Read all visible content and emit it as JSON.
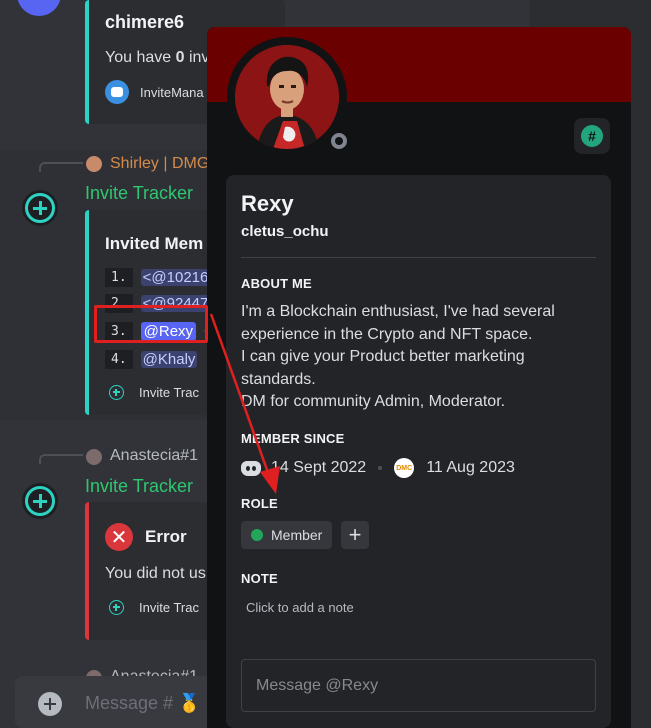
{
  "chat": {
    "msg1": {
      "author": "chimere6",
      "body_prefix": "You have ",
      "body_bold": "0",
      "body_suffix": " inv",
      "footer": "InviteMana"
    },
    "msg2": {
      "reply_author": "Shirley | DMG",
      "bot_name": "Invite Tracker",
      "embed_title": "Invited Mem",
      "list": [
        {
          "num": "1.",
          "mention": "<@10216"
        },
        {
          "num": "2.",
          "mention": "<@92447"
        },
        {
          "num": "3.",
          "mention": "@Rexy",
          "trail": "•"
        },
        {
          "num": "4.",
          "mention": "@Khaly"
        }
      ],
      "footer": "Invite Trac"
    },
    "msg3": {
      "reply_author": "Anastecia#1",
      "bot_name": "Invite Tracker",
      "embed_title": "Error",
      "body": "You did not us",
      "footer": "Invite Trac"
    },
    "msg4_reply_author": "Anastecia#1",
    "message_placeholder": "Message # 🥇"
  },
  "profile": {
    "display_name": "Rexy",
    "username": "cletus_ochu",
    "about_title": "ABOUT ME",
    "about_lines": [
      "I'm a Blockchain enthusiast, I've had several",
      "experience in the Crypto and NFT space.",
      "I can give your Product better marketing",
      "standards.",
      "DM for community Admin, Moderator."
    ],
    "member_since_title": "MEMBER SINCE",
    "discord_since": "14 Sept 2022",
    "server_since": "11 Aug 2023",
    "server_icon_text": "DMC",
    "role_title": "ROLE",
    "role_name": "Member",
    "role_color": "#23a55a",
    "role_add": "+",
    "note_title": "NOTE",
    "note_placeholder": "Click to add a note",
    "message_placeholder": "Message @Rexy",
    "banner_color": "#6b0000",
    "badge_symbol": "#"
  },
  "annotation": {
    "box_color": "#e02020",
    "arrow_color": "#e02020"
  }
}
